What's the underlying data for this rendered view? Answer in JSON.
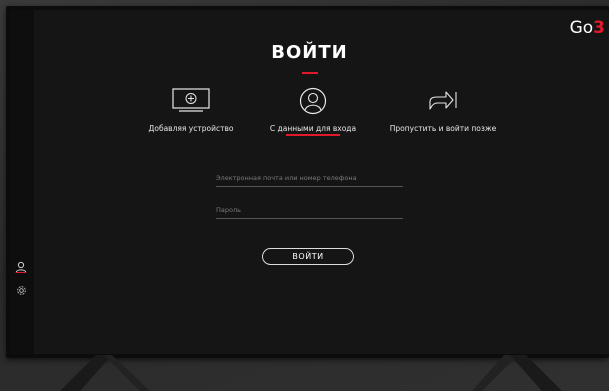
{
  "brand": {
    "logo_prefix": "Go",
    "logo_accent": "3",
    "accent_color": "#e3192b"
  },
  "sidebar": {
    "items": [
      {
        "icon": "user-icon"
      },
      {
        "icon": "gear-icon"
      }
    ]
  },
  "main": {
    "title": "ВОЙТИ",
    "options": [
      {
        "label": "Добавляя устройство",
        "icon": "tv-add-icon",
        "active": false
      },
      {
        "label": "С данными для входа",
        "icon": "user-circle-icon",
        "active": true
      },
      {
        "label": "Пропустить и войти позже",
        "icon": "share-arrow-icon",
        "active": false
      }
    ],
    "email_placeholder": "Электронная почта или номер телефона",
    "password_placeholder": "Пароль",
    "submit_label": "ВОЙТИ"
  }
}
